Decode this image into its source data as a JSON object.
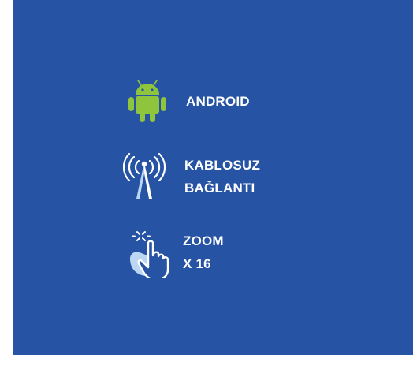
{
  "colors": {
    "panel_background": "#2653a3",
    "android_green": "#8fc43d",
    "icon_white": "#ffffff",
    "icon_light_blue": "#bcd7f4"
  },
  "features": [
    {
      "icon": "android-icon",
      "lines": [
        "ANDROID"
      ]
    },
    {
      "icon": "wireless-antenna-icon",
      "lines": [
        "KABLOSUZ",
        "BAĞLANTI"
      ]
    },
    {
      "icon": "touch-zoom-icon",
      "lines": [
        "ZOOM",
        "X 16"
      ]
    }
  ]
}
